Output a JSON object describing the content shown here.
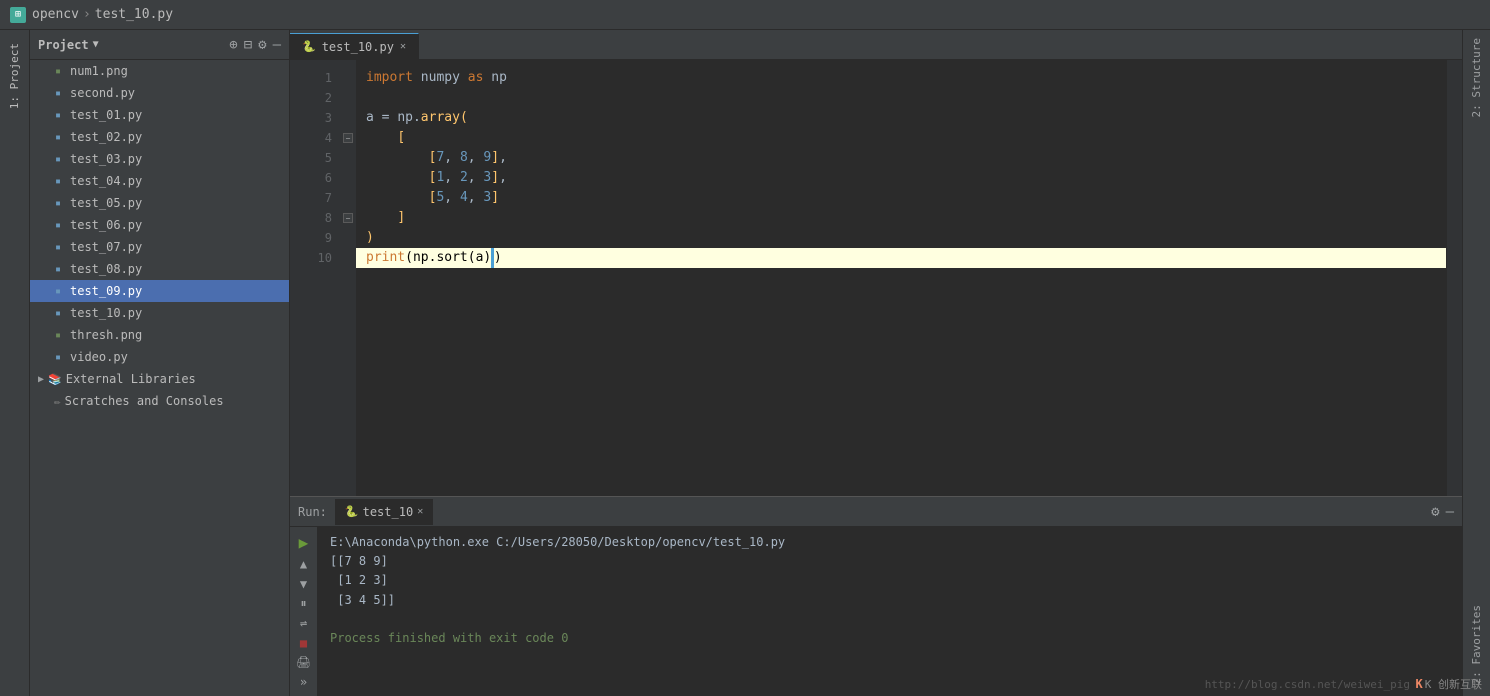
{
  "titleBar": {
    "projectName": "opencv",
    "fileName": "test_10.py"
  },
  "projectPanel": {
    "title": "Project",
    "files": [
      {
        "name": "num1.png",
        "type": "png"
      },
      {
        "name": "second.py",
        "type": "py"
      },
      {
        "name": "test_01.py",
        "type": "py"
      },
      {
        "name": "test_02.py",
        "type": "py"
      },
      {
        "name": "test_03.py",
        "type": "py"
      },
      {
        "name": "test_04.py",
        "type": "py"
      },
      {
        "name": "test_05.py",
        "type": "py"
      },
      {
        "name": "test_06.py",
        "type": "py"
      },
      {
        "name": "test_07.py",
        "type": "py"
      },
      {
        "name": "test_08.py",
        "type": "py"
      },
      {
        "name": "test_09.py",
        "type": "py",
        "selected": true
      },
      {
        "name": "test_10.py",
        "type": "py"
      },
      {
        "name": "thresh.png",
        "type": "png"
      },
      {
        "name": "video.py",
        "type": "py"
      }
    ],
    "sections": [
      {
        "name": "External Libraries",
        "expanded": false
      },
      {
        "name": "Scratches and Consoles",
        "expanded": false
      }
    ]
  },
  "editor": {
    "activeTab": "test_10.py",
    "lines": [
      {
        "num": 1,
        "content": "import numpy as np",
        "type": "import"
      },
      {
        "num": 2,
        "content": ""
      },
      {
        "num": 3,
        "content": "a = np.array("
      },
      {
        "num": 4,
        "content": "    [",
        "foldable": true
      },
      {
        "num": 5,
        "content": "        [7, 8, 9],"
      },
      {
        "num": 6,
        "content": "        [1, 2, 3],"
      },
      {
        "num": 7,
        "content": "        [5, 4, 3]"
      },
      {
        "num": 8,
        "content": "    ]",
        "foldable": true
      },
      {
        "num": 9,
        "content": ")"
      },
      {
        "num": 10,
        "content": "print(np.sort(a))",
        "highlighted": true
      }
    ]
  },
  "runPanel": {
    "label": "Run:",
    "activeTab": "test_10",
    "output": [
      {
        "text": "E:\\Anaconda\\python.exe C:/Users/28050/Desktop/opencv/test_10.py",
        "type": "path"
      },
      {
        "text": "[[7 8 9]",
        "type": "output"
      },
      {
        "text": " [1 2 3]",
        "type": "output"
      },
      {
        "text": " [3 4 5]]",
        "type": "output"
      },
      {
        "text": "",
        "type": "output"
      },
      {
        "text": "Process finished with exit code 0",
        "type": "success"
      }
    ]
  },
  "sidebar": {
    "topTabs": [
      "1: Project"
    ],
    "bottomTabs": [
      "2: Favorites"
    ]
  },
  "rightSidebar": {
    "tabs": [
      "2: Structure"
    ]
  },
  "watermark": "http://blog.csdn.net/weiwei_pig",
  "brand": "K 创新互联"
}
